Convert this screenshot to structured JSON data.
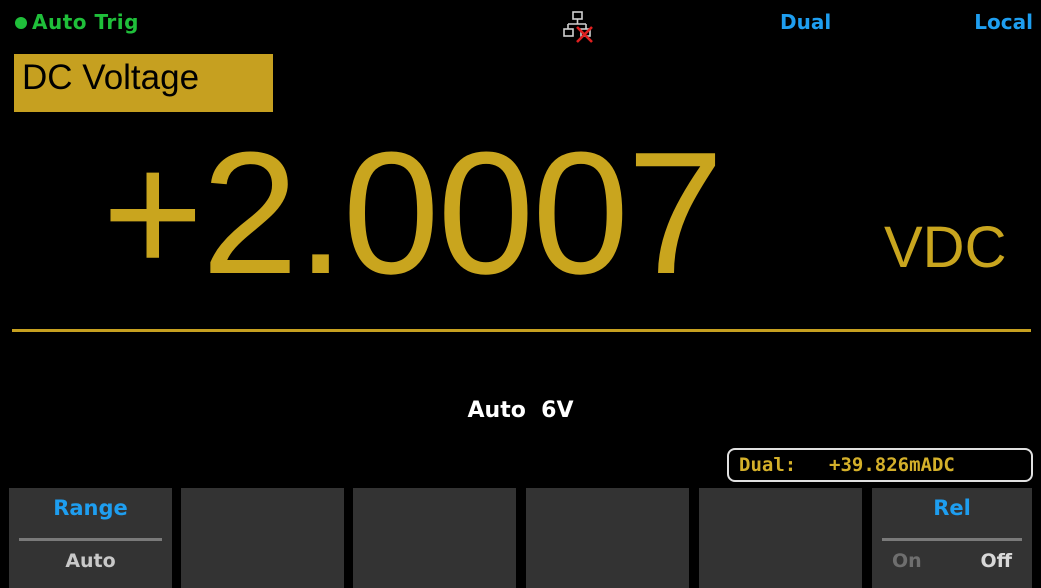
{
  "status": {
    "trigger": "Auto Trig",
    "network_icon": "lan-disconnected-icon",
    "mode": "Dual",
    "control": "Local",
    "indicator_color": "#1fbf3a",
    "info_color": "#1e9ef0"
  },
  "function": {
    "label": "DC Voltage",
    "box_color": "#c6a020"
  },
  "measurement": {
    "value": "+2.0007",
    "unit": "VDC",
    "color": "#c9a51e"
  },
  "range_info": "Auto  6V",
  "dual": {
    "label": "Dual:",
    "value": "+39.826mADC"
  },
  "softkeys": {
    "range": {
      "title": "Range",
      "value": "Auto"
    },
    "rel": {
      "title": "Rel",
      "on": "On",
      "off": "Off",
      "selected": "Off"
    }
  }
}
